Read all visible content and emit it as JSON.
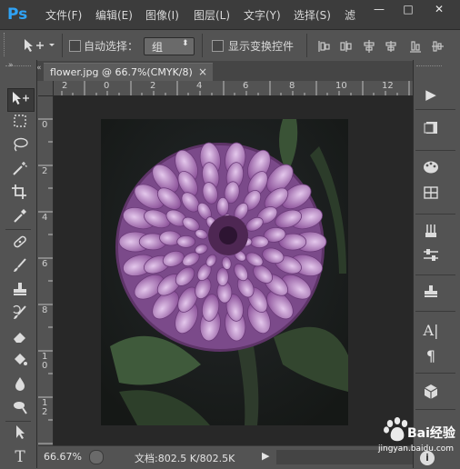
{
  "app": {
    "logo": "Ps"
  },
  "menu": [
    "文件(F)",
    "编辑(E)",
    "图像(I)",
    "图层(L)",
    "文字(Y)",
    "选择(S)",
    "滤"
  ],
  "window_controls": {
    "minimize": "—",
    "restore": "□",
    "close": "✕"
  },
  "options_bar": {
    "auto_select_label": "自动选择：",
    "auto_select_value": "组",
    "show_transform_label": "显示变换控件"
  },
  "document": {
    "tab_title": "flower.jpg @ 66.7%(CMYK/8)",
    "tab_close": "×",
    "zoom": "66.67%",
    "doc_info": "文档:802.5 K/802.5K"
  },
  "ruler": {
    "horizontal": [
      "2",
      "0",
      "2",
      "4",
      "6",
      "8",
      "10",
      "12"
    ],
    "vertical": [
      "0",
      "2",
      "4",
      "6",
      "8",
      "1\n0",
      "1\n2",
      "1\n4"
    ]
  },
  "watermark": {
    "brand": "Bai经验",
    "url": "jingyan.baidu.com"
  },
  "colors": {
    "app_bg": "#535353",
    "menubar": "#3c3c3c",
    "canvas_bg": "#282828",
    "logo": "#2fa3f6",
    "flower_light": "#c9a3d8",
    "flower_dark": "#7c4b8e"
  }
}
